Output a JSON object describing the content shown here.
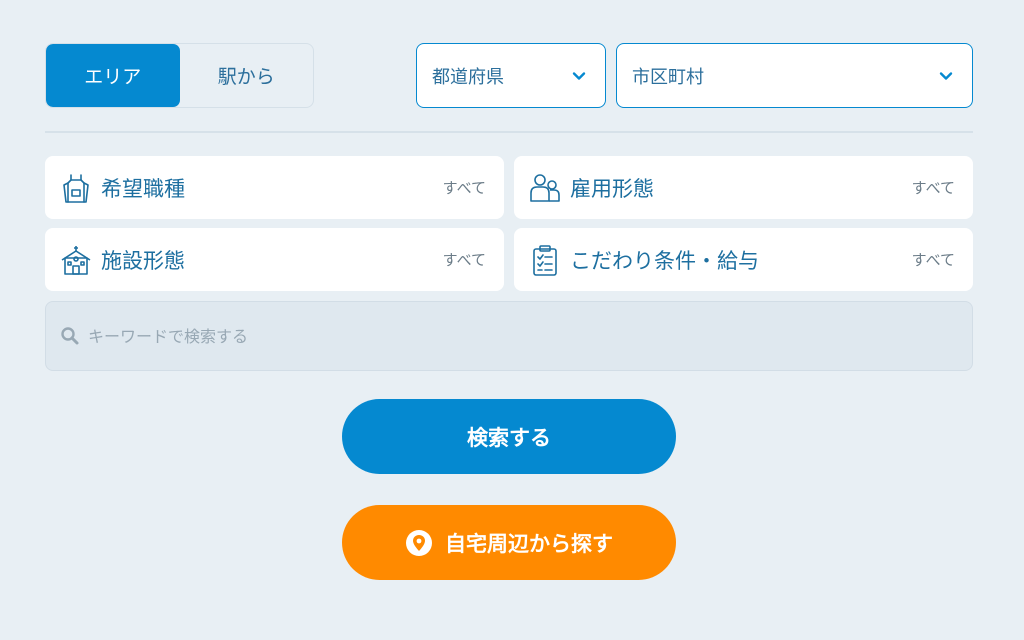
{
  "tabs": [
    {
      "label": "エリア",
      "active": true
    },
    {
      "label": "駅から",
      "active": false
    }
  ],
  "selects": {
    "prefecture": "都道府県",
    "city": "市区町村"
  },
  "filters": [
    {
      "label": "希望職種",
      "value": "すべて",
      "icon": "apron-icon"
    },
    {
      "label": "雇用形態",
      "value": "すべて",
      "icon": "people-icon"
    },
    {
      "label": "施設形態",
      "value": "すべて",
      "icon": "facility-icon"
    },
    {
      "label": "こだわり条件・給与",
      "value": "すべて",
      "icon": "clipboard-checklist-icon"
    }
  ],
  "keyword": {
    "placeholder": "キーワードで検索する",
    "value": ""
  },
  "buttons": {
    "search": "検索する",
    "nearby": "自宅周辺から探す"
  },
  "colors": {
    "accent": "#0589d0",
    "orange": "#ff8a00",
    "background": "#e8eff4"
  }
}
